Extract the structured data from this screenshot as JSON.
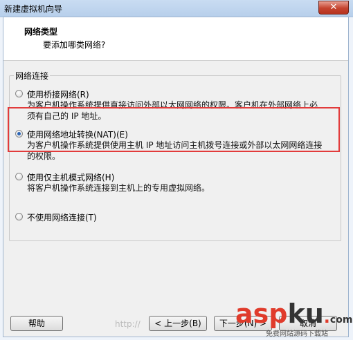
{
  "window": {
    "title": "新建虚拟机向导",
    "close_label": "✕"
  },
  "header": {
    "title": "网络类型",
    "subtitle": "要添加哪类网络?"
  },
  "group": {
    "legend": "网络连接",
    "options": [
      {
        "label": "使用桥接网络(R)",
        "desc": "为客户机操作系统提供直接访问外部以太网网络的权限。客户机在外部网络上必须有自己的 IP 地址。",
        "checked": false
      },
      {
        "label": "使用网络地址转换(NAT)(E)",
        "desc": "为客户机操作系统提供使用主机 IP 地址访问主机拨号连接或外部以太网网络连接的权限。",
        "checked": true
      },
      {
        "label": "使用仅主机模式网络(H)",
        "desc": "将客户机操作系统连接到主机上的专用虚拟网络。",
        "checked": false
      },
      {
        "label": "不使用网络连接(T)",
        "desc": "",
        "checked": false
      }
    ]
  },
  "buttons": {
    "help": "帮助",
    "back": "< 上一步(B)",
    "next": "下一步(N) >",
    "cancel": "取消"
  },
  "watermark": {
    "faint": "http://",
    "logo_part1": "asp",
    "logo_part2": "ku",
    "logo_dot": ".",
    "logo_tld": "com",
    "sub": "免费网站源码下载站"
  }
}
